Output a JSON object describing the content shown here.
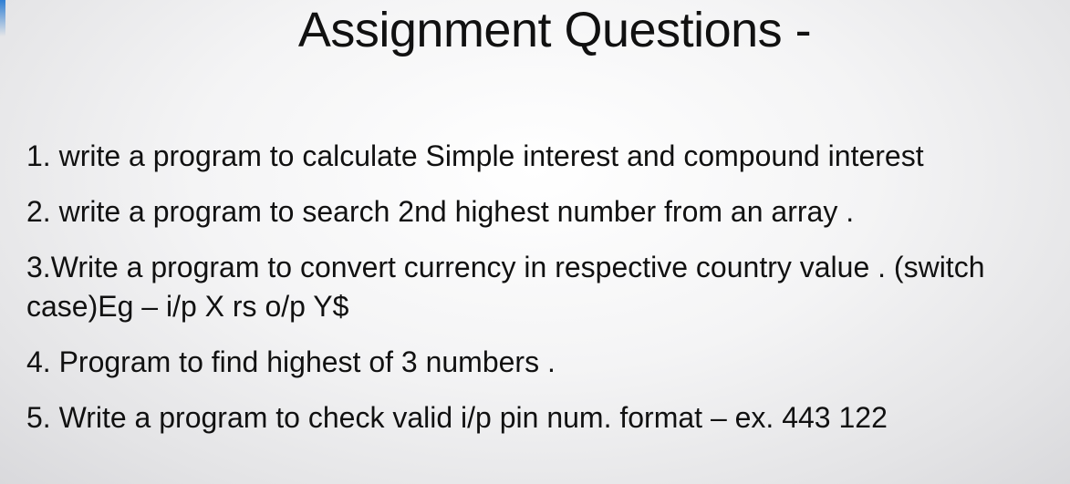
{
  "slide": {
    "title": "Assignment Questions -",
    "questions": [
      "1. write a program to calculate Simple interest and compound interest",
      "2. write a program to search 2nd highest number from an array .",
      "3.Write a program to convert currency in respective country value . (switch case)Eg – i/p X rs o/p Y$",
      "4. Program to find highest of 3 numbers .",
      "5. Write a program to check valid  i/p pin num. format – ex. 443 122"
    ]
  }
}
